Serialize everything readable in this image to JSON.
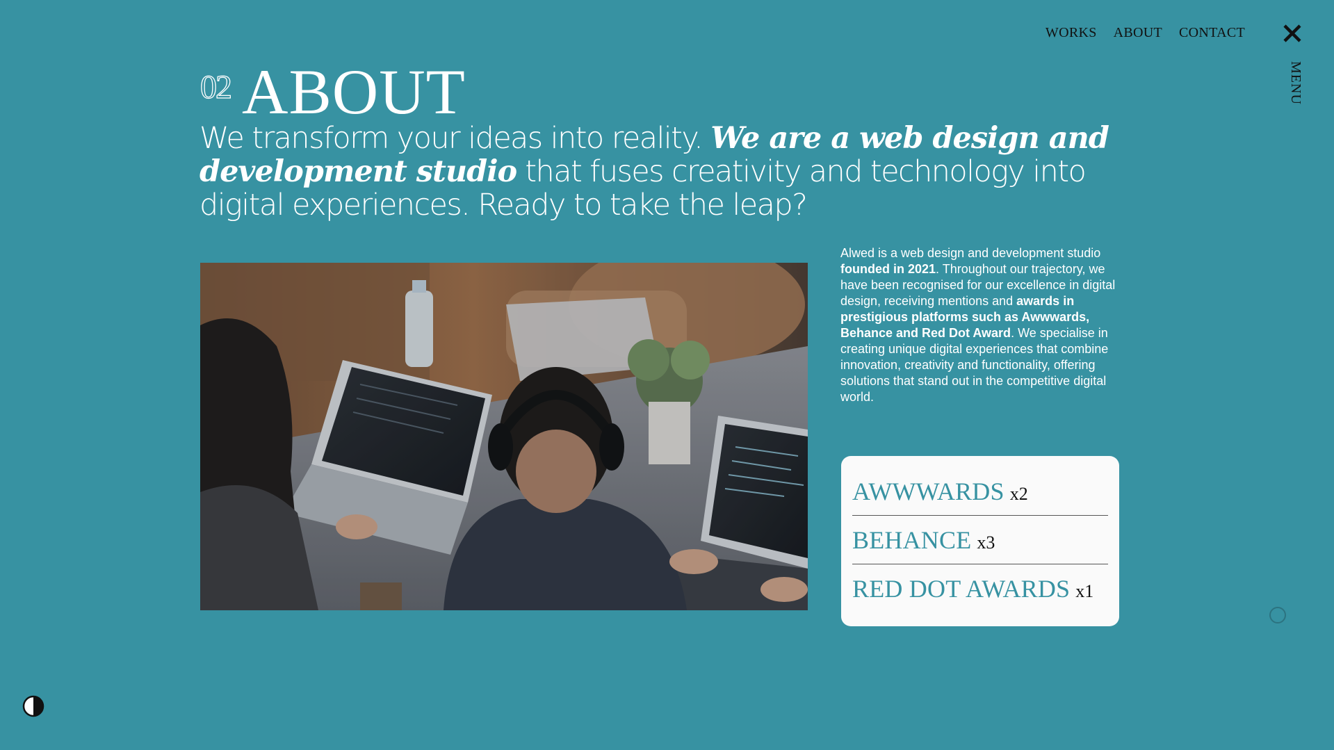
{
  "nav": {
    "links": [
      "WORKS",
      "ABOUT",
      "CONTACT"
    ],
    "menu_label": "MENU",
    "close_icon": "close-icon"
  },
  "section": {
    "number": "02",
    "title": "ABOUT"
  },
  "lead": {
    "part1": "We transform your ideas into reality. ",
    "emphasis": "We are a web design and development studio",
    "part2": " that fuses creativity and technology into digital experiences. Ready to take the leap?"
  },
  "description": {
    "t1": "Alwed is a web design and development studio ",
    "b1": "founded in 2021",
    "t2": ". Throughout our trajectory, we have been recognised for our excellence in digital design, receiving mentions and ",
    "b2": "awards in prestigious platforms such as Awwwards, Behance and Red Dot Award",
    "t3": ". We specialise in creating unique digital experiences that combine innovation, creativity and functionality, offering solutions that stand out in the competitive digital world."
  },
  "awards": [
    {
      "name": "AWWWARDS",
      "count": "x2"
    },
    {
      "name": "BEHANCE",
      "count": "x3"
    },
    {
      "name": "RED DOT AWARDS",
      "count": "x1"
    }
  ],
  "colors": {
    "background": "#3792a2",
    "card": "#fafafa",
    "accent_text": "#3792a2",
    "dark_text": "#111111"
  },
  "icons": {
    "theme_toggle": "half-circle-contrast-icon",
    "cursor": "circle-cursor-icon"
  }
}
